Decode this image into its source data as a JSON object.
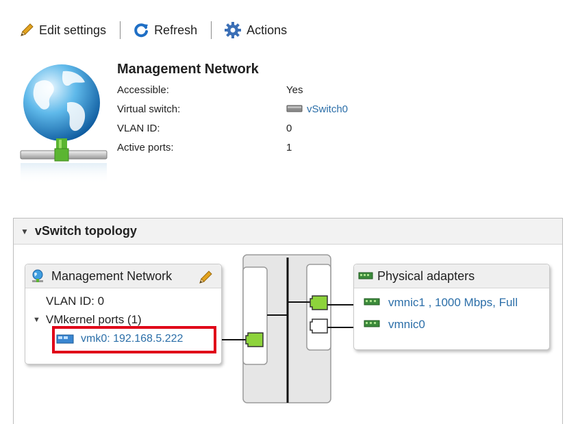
{
  "toolbar": {
    "edit_label": "Edit settings",
    "refresh_label": "Refresh",
    "actions_label": "Actions"
  },
  "network": {
    "title": "Management Network",
    "properties": [
      {
        "label": "Accessible:",
        "value": "Yes"
      },
      {
        "label": "Virtual switch:",
        "value": "vSwitch0"
      },
      {
        "label": "VLAN ID:",
        "value": "0"
      },
      {
        "label": "Active ports:",
        "value": "1"
      }
    ]
  },
  "topology": {
    "header": "vSwitch topology",
    "portgroup": {
      "name": "Management Network",
      "vlan": "VLAN ID: 0",
      "vmkernel_ports": "VMkernel ports (1)",
      "vmk": "vmk0: 192.168.5.222"
    },
    "physical": {
      "header": "Physical adapters",
      "adapters": [
        {
          "name": "vmnic1 , 1000 Mbps, Full"
        },
        {
          "name": "vmnic0"
        }
      ]
    }
  },
  "colors": {
    "link": "#2b6ea8",
    "highlight_border": "#e00018",
    "port_active": "#8dd33b"
  }
}
